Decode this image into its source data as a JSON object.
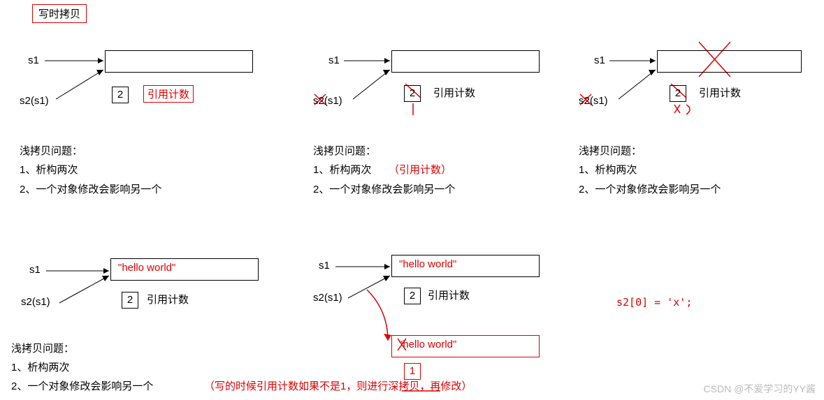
{
  "title": "写时拷贝",
  "labels": {
    "s1": "s1",
    "s2s1": "s2(s1)",
    "ref_count": "引用计数"
  },
  "counts": {
    "two": "2",
    "one": "1"
  },
  "issue": {
    "heading": "浅拷贝问题：",
    "item1": "1、析构两次",
    "item2": "2、一个对象修改会影响另一个",
    "item1_note": "（引用计数）"
  },
  "hello": "\"hello world\"",
  "code": "s2[0] = 'x';",
  "footnote": "（写的时候引用计数如果不是1，则进行深拷贝，再修改）",
  "watermark": "CSDN @不爱学习的YY酱"
}
